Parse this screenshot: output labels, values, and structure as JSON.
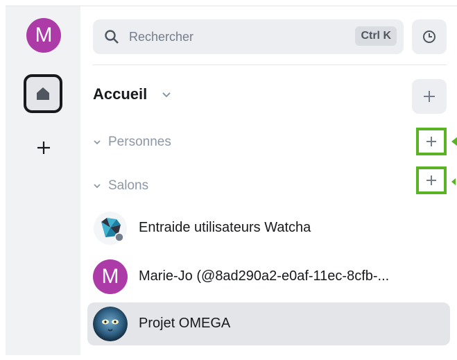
{
  "space_rail": {
    "user_avatar_letter": "M",
    "avatar_color": "#ac3ba8",
    "add_space_glyph": "+"
  },
  "search": {
    "placeholder": "Rechercher",
    "shortcut": "Ctrl K"
  },
  "home": {
    "title": "Accueil"
  },
  "sections": [
    {
      "label": "Personnes"
    },
    {
      "label": "Salons"
    }
  ],
  "rooms": [
    {
      "name": "Entraide utilisateurs Watcha",
      "avatar": "watcha-logo-icon"
    },
    {
      "name": "Marie-Jo (@8ad290a2-e0af-11ec-8cfb-...",
      "avatar_letter": "M"
    },
    {
      "name": "Projet OMEGA",
      "avatar": "photo-avatar",
      "selected": true
    }
  ],
  "colors": {
    "highlight_green": "#5ab325",
    "selected_row": "#e3e5e8",
    "muted_text": "#8d97a5"
  }
}
